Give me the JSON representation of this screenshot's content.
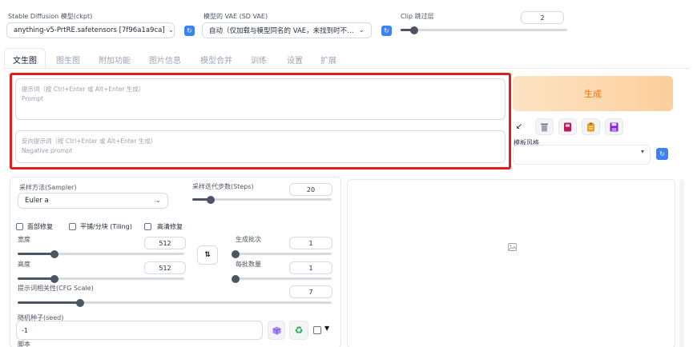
{
  "top": {
    "ckpt_label": "Stable Diffusion 模型(ckpt)",
    "ckpt_value": "anything-v5-PrtRE.safetensors [7f96a1a9ca]",
    "vae_label": "模型的 VAE (SD VAE)",
    "vae_value": "自动（仅加载与模型同名的 VAE，未找到时不…",
    "clip_label": "Clip 跳过层",
    "clip_value": "2",
    "clip_fraction": 0.08
  },
  "tabs": [
    {
      "label": "文生图",
      "active": true
    },
    {
      "label": "图生图"
    },
    {
      "label": "附加功能"
    },
    {
      "label": "图片信息"
    },
    {
      "label": "模型合并"
    },
    {
      "label": "训练"
    },
    {
      "label": "设置"
    },
    {
      "label": "扩展"
    }
  ],
  "prompt": {
    "hint": "提示词（按 Ctrl+Enter 或 Alt+Enter 生成）",
    "placeholder": "Prompt"
  },
  "negative": {
    "hint": "反向提示词（按 Ctrl+Enter 或 Alt+Enter 生成）",
    "placeholder": "Negative prompt"
  },
  "generate_label": "生成",
  "style_label": "模板风格",
  "sampler": {
    "label": "采样方法(Sampler)",
    "value": "Euler a"
  },
  "steps": {
    "label": "采样迭代步数(Steps)",
    "value": "20",
    "fraction": 0.13
  },
  "checks": {
    "face": "面部修复",
    "tiling": "平铺/分块 (Tiling)",
    "hires": "高清修复"
  },
  "width": {
    "label": "宽度",
    "value": "512",
    "fraction": 0.22
  },
  "height": {
    "label": "高度",
    "value": "512",
    "fraction": 0.22
  },
  "batch_count": {
    "label": "生成批次",
    "value": "1",
    "fraction": 0.0
  },
  "batch_size": {
    "label": "每批数量",
    "value": "1",
    "fraction": 0.0
  },
  "cfg": {
    "label": "提示词相关性(CFG Scale)",
    "value": "7",
    "fraction": 0.2
  },
  "seed": {
    "label": "随机种子(seed)",
    "value": "-1"
  },
  "script_label": "脚本",
  "colors": {
    "accent": "#f97316",
    "generate_bg": "#fcd9b3",
    "highlight": "#e11d1d",
    "refresh": "#3b82f6"
  }
}
